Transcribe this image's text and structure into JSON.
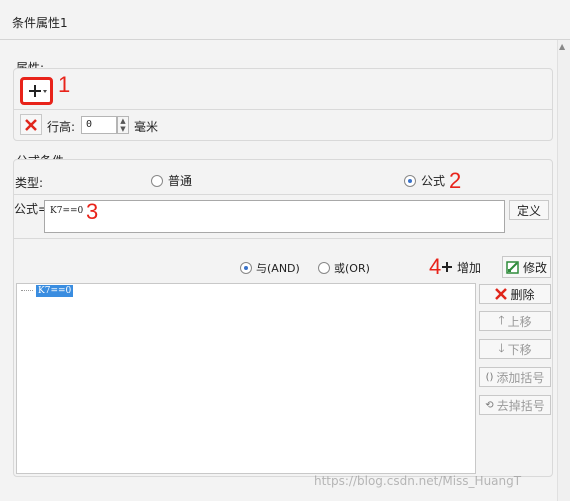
{
  "tab": {
    "title": "条件属性1"
  },
  "properties": {
    "section_label": "属性:",
    "annotation_1": "1",
    "row_height_label": "行高:",
    "row_height_value": "0",
    "unit": "毫米"
  },
  "formula_condition": {
    "section_label": "公式条件",
    "type_label": "类型:",
    "option_normal": "普通",
    "option_formula": "公式",
    "annotation_2": "2",
    "formula_label": "公式=",
    "formula_value": "K7==0",
    "annotation_3": "3",
    "define_button": "定义"
  },
  "logic": {
    "and_label": "与(AND)",
    "or_label": "或(OR)",
    "annotation_4": "4",
    "add_button": "增加",
    "modify_button": "修改"
  },
  "condition_list": {
    "items": [
      "K7==0"
    ]
  },
  "side_buttons": {
    "delete": "删除",
    "move_up": "上移",
    "move_down": "下移",
    "add_bracket": "添加括号",
    "remove_bracket": "去掉括号"
  },
  "watermark": "https://blog.csdn.net/Miss_HuangT",
  "colors": {
    "accent": "#3a73c9",
    "annotation": "#e8231a",
    "selection": "#3a8de0"
  }
}
